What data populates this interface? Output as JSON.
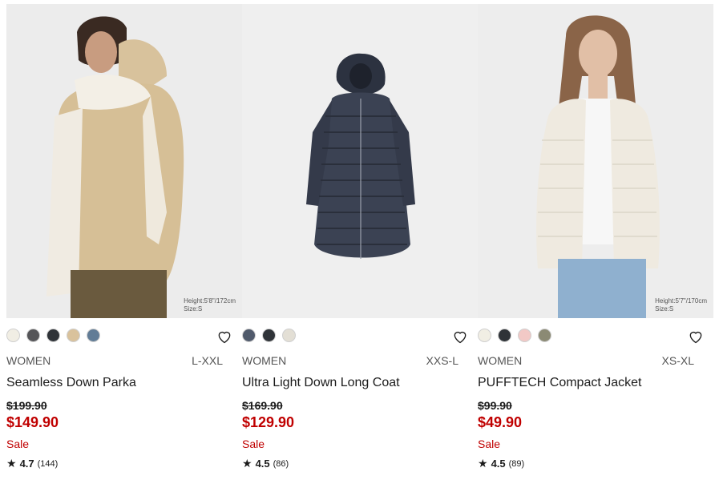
{
  "products": [
    {
      "caption": "Height:5'8\"/172cm\nSize:S",
      "gender": "WOMEN",
      "size_range": "L-XXL",
      "name": "Seamless Down Parka",
      "original_price": "$199.90",
      "sale_price": "$149.90",
      "sale_label": "Sale",
      "rating": "4.7",
      "reviews": "(144)",
      "colors": [
        "#f1eee4",
        "#555558",
        "#2f3338",
        "#d9c29c",
        "#617c96"
      ]
    },
    {
      "caption": "",
      "gender": "WOMEN",
      "size_range": "XXS-L",
      "name": "Ultra Light Down Long Coat",
      "original_price": "$169.90",
      "sale_price": "$129.90",
      "sale_label": "Sale",
      "rating": "4.5",
      "reviews": "(86)",
      "colors": [
        "#505a6b",
        "#2f3338",
        "#e3dfd5"
      ]
    },
    {
      "caption": "Height:5'7\"/170cm\nSize:S",
      "gender": "WOMEN",
      "size_range": "XS-XL",
      "name": "PUFFTECH Compact Jacket",
      "original_price": "$99.90",
      "sale_price": "$49.90",
      "sale_label": "Sale",
      "rating": "4.5",
      "reviews": "(89)",
      "colors": [
        "#f1eee4",
        "#2f3338",
        "#f2c9c6",
        "#8b8a74"
      ]
    }
  ],
  "icons": {
    "favorite": "heart-outline-icon",
    "rating": "star-icon"
  },
  "accent": "#c00000"
}
